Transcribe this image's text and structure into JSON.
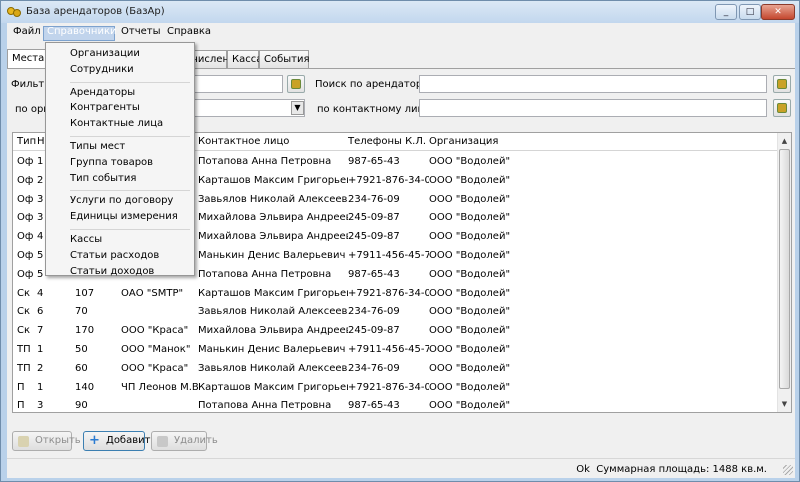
{
  "window": {
    "title": "База арендаторов (БазАр)"
  },
  "menubar": [
    "Файл",
    "Справочники",
    "Отчеты",
    "Справка"
  ],
  "dropdown": {
    "groups": [
      [
        "Организации",
        "Сотрудники"
      ],
      [
        "Арендаторы",
        "Контрагенты",
        "Контактные лица"
      ],
      [
        "Типы мест",
        "Группа товаров",
        "Тип события"
      ],
      [
        "Услуги по договору",
        "Единицы измерения"
      ],
      [
        "Кассы",
        "Статьи расходов",
        "Статьи доходов"
      ]
    ]
  },
  "tabs": [
    "Места",
    "числения",
    "Касса",
    "События"
  ],
  "filters": {
    "filter_label": "Фильтр",
    "org_label": "по орг",
    "search_tenant_label": "Поиск по арендатору:",
    "contact_label": "по контактному лицу"
  },
  "grid": {
    "headers": [
      "Тип",
      "Н",
      "",
      "",
      "Контактное лицо",
      "Телефоны К.Л.",
      "Организация"
    ],
    "rows": [
      [
        "Оф",
        "1",
        "",
        "",
        "Потапова Анна Петровна",
        "987-65-43",
        "ООО \"Водолей\""
      ],
      [
        "Оф",
        "2",
        "",
        "",
        "Карташов Максим Григорьевич",
        "+7921-876-34-09",
        "ООО \"Водолей\""
      ],
      [
        "Оф",
        "3",
        "",
        "",
        "Завьялов Николай Алексеевич",
        "234-76-09",
        "ООО \"Водолей\""
      ],
      [
        "Оф",
        "3",
        "",
        "",
        "Михайлова Эльвира Андреевна",
        "245-09-87",
        "ООО \"Водолей\""
      ],
      [
        "Оф",
        "4",
        "",
        "",
        "Михайлова Эльвира Андреевна",
        "245-09-87",
        "ООО \"Водолей\""
      ],
      [
        "Оф",
        "5",
        "",
        "",
        "Манькин Денис Валерьевич",
        "+7911-456-45-78",
        "ООО \"Водолей\""
      ],
      [
        "Оф",
        "5",
        "",
        "",
        "Потапова Анна Петровна",
        "987-65-43",
        "ООО \"Водолей\""
      ],
      [
        "Ск",
        "4",
        "107",
        "ОАО \"SMTP\"",
        "Карташов Максим Григорьевич",
        "+7921-876-34-09",
        "ООО \"Водолей\""
      ],
      [
        "Ск",
        "6",
        "70",
        "",
        "Завьялов Николай Алексеевич",
        "234-76-09",
        "ООО \"Водолей\""
      ],
      [
        "Ск",
        "7",
        "170",
        "ООО \"Краса\"",
        "Михайлова Эльвира Андреевна",
        "245-09-87",
        "ООО \"Водолей\""
      ],
      [
        "ТП",
        "1",
        "50",
        "ООО \"Манок\"",
        "Манькин Денис Валерьевич",
        "+7911-456-45-78",
        "ООО \"Водолей\""
      ],
      [
        "ТП",
        "2",
        "60",
        "ООО \"Краса\"",
        "Завьялов Николай Алексеевич",
        "234-76-09",
        "ООО \"Водолей\""
      ],
      [
        "П",
        "1",
        "140",
        "ЧП Леонов М.В.",
        "Карташов Максим Григорьевич",
        "+7921-876-34-09",
        "ООО \"Водолей\""
      ],
      [
        "П",
        "3",
        "90",
        "",
        "Потапова Анна Петровна",
        "987-65-43",
        "ООО \"Водолей\""
      ]
    ]
  },
  "buttons": {
    "open": "Открыть",
    "add": "Добавить",
    "delete": "Удалить"
  },
  "status": {
    "ok": "Ok",
    "area": "Суммарная площадь: 1488 кв.м."
  }
}
